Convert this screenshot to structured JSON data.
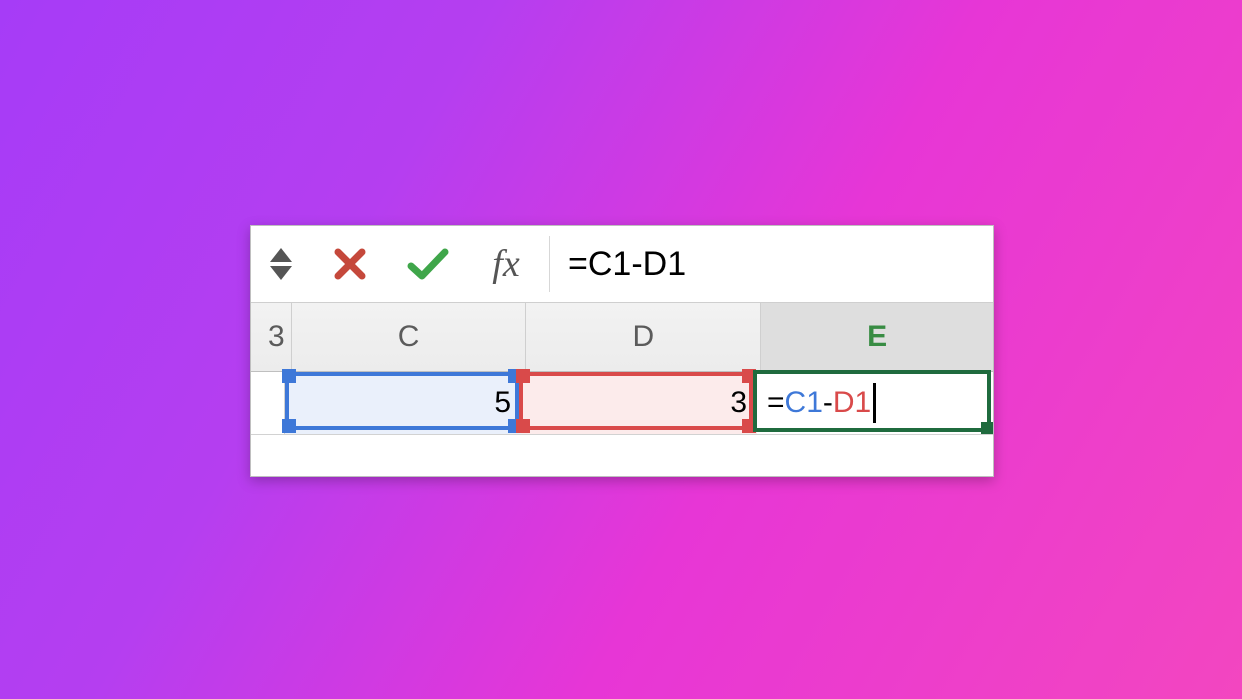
{
  "formula_bar": {
    "stepper_label": "step",
    "cancel_icon": "x",
    "accept_icon": "check",
    "fx_label": "fx",
    "formula_text": "=C1-D1"
  },
  "columns": {
    "B_partial": "3",
    "C": "C",
    "D": "D",
    "E": "E",
    "active": "E"
  },
  "cells": {
    "C1": "5",
    "D1": "3",
    "E1_eq": "=",
    "E1_ref1": "C1",
    "E1_dash": "-",
    "E1_ref2": "D1"
  },
  "colors": {
    "ref1": "#3e78d8",
    "ref2": "#d94a4a",
    "active": "#1f6b3e"
  }
}
